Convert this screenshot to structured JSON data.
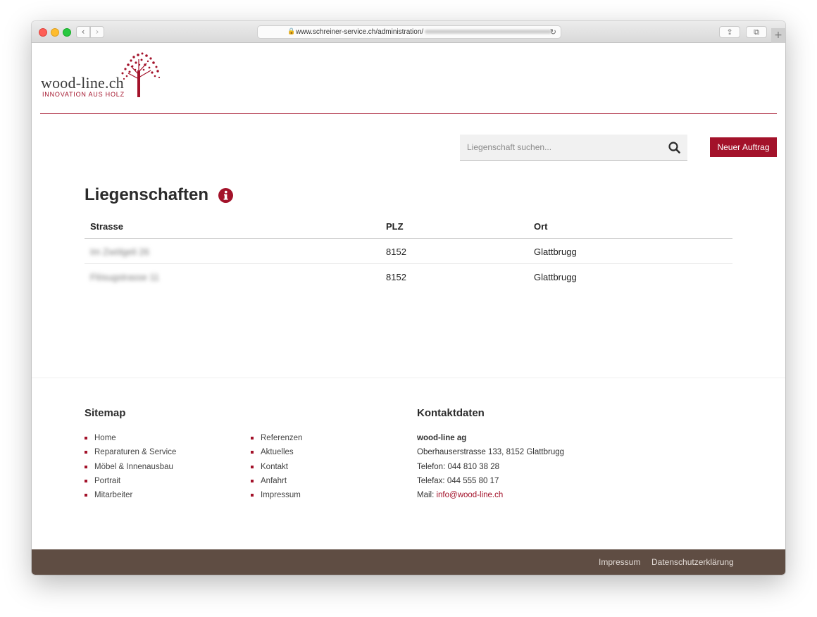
{
  "browser": {
    "url": "www.schreiner-service.ch/administration/",
    "url_obscured": "blurred"
  },
  "logo": {
    "wordmark": "wood-line.ch",
    "tagline": "INNOVATION  AUS HOLZ"
  },
  "search": {
    "placeholder": "Liegenschaft suchen..."
  },
  "actions": {
    "new_order_label": "Neuer Auftrag"
  },
  "page": {
    "title": "Liegenschaften"
  },
  "table": {
    "headers": [
      "Strasse",
      "PLZ",
      "Ort"
    ],
    "rows": [
      {
        "strasse": "Im Zwölgeli 26",
        "plz": "8152",
        "ort": "Glattbrugg"
      },
      {
        "strasse": "Flösugstrasse 11",
        "plz": "8152",
        "ort": "Glattbrugg"
      }
    ]
  },
  "footer": {
    "sitemap_title": "Sitemap",
    "sitemap_col1": [
      "Home",
      "Reparaturen & Service",
      "Möbel & Innenausbau",
      "Portrait",
      "Mitarbeiter"
    ],
    "sitemap_col2": [
      "Referenzen",
      "Aktuelles",
      "Kontakt",
      "Anfahrt",
      "Impressum"
    ],
    "contact_title": "Kontaktdaten",
    "company": "wood-line ag",
    "address": "Oberhauserstrasse 133, 8152 Glattbrugg",
    "phone": "Telefon: 044 810 38 28",
    "fax": "Telefax: 044 555 80 17",
    "mail_label": "Mail: ",
    "mail": "info@wood-line.ch",
    "bottom_links": [
      "Impressum",
      "Datenschutzerklärung"
    ]
  },
  "colors": {
    "brand": "#a3122a",
    "footer_bar": "#5f4d43"
  }
}
